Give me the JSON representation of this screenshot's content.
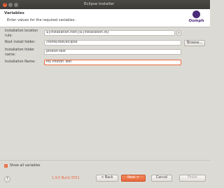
{
  "window": {
    "title": "Eclipse Installer",
    "close_glyph": "×",
    "min_glyph": "",
    "max_glyph": ""
  },
  "header": {
    "title": "Variables",
    "description": "Enter values for the required variables.",
    "logo_text": "Oomph"
  },
  "form": {
    "install_location_label": "Installation location rule:",
    "install_location_value": "${installation.root}/${installation.id}",
    "root_folder_label": "Root install folder:",
    "root_folder_value": "/home/test/eclipse",
    "browse_label": "Browse...",
    "folder_name_label": "Installation folder name:",
    "folder_name_value": "photon-test",
    "install_name_label": "Installation Name:",
    "install_name_value": "My Photon Test"
  },
  "footer": {
    "show_all_label": "Show all variables",
    "show_all_checked": true,
    "help_glyph": "?",
    "build": "1.9.0 Build 3551",
    "back_label": "< Back",
    "next_label": "Next >",
    "cancel_label": "Cancel",
    "finish_label": "Finish"
  },
  "colors": {
    "accent": "#e9683c",
    "brand": "#4b2a7a",
    "titlebar": "#3c3b37"
  }
}
